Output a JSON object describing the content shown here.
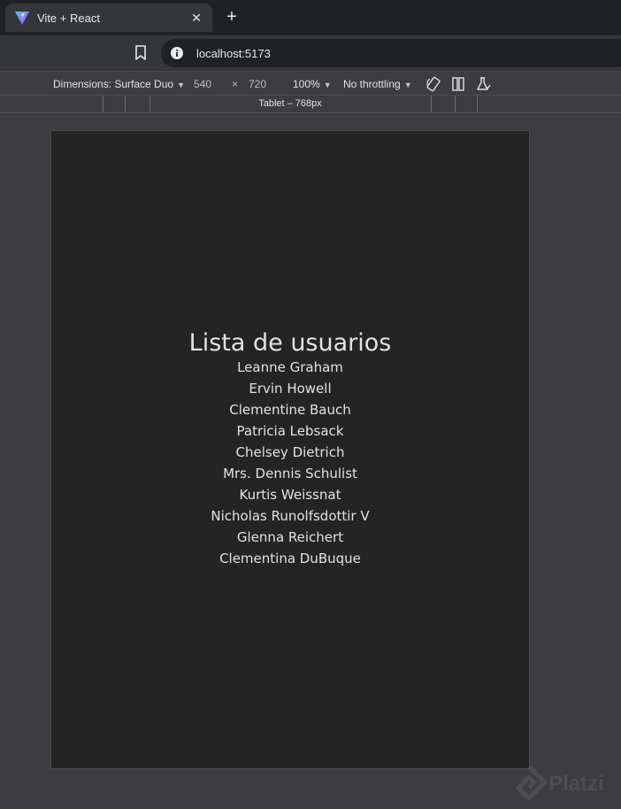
{
  "tab": {
    "title": "Vite + React",
    "close_glyph": "✕",
    "new_tab_glyph": "+"
  },
  "address_bar": {
    "url": "localhost:5173"
  },
  "device_toolbar": {
    "dimensions_label": "Dimensions: Surface Duo",
    "width": "540",
    "times": "×",
    "height": "720",
    "zoom": "100%",
    "throttling": "No throttling"
  },
  "media_query": {
    "label": "Tablet – 768px"
  },
  "app": {
    "heading": "Lista de usuarios",
    "users": [
      "Leanne Graham",
      "Ervin Howell",
      "Clementine Bauch",
      "Patricia Lebsack",
      "Chelsey Dietrich",
      "Mrs. Dennis Schulist",
      "Kurtis Weissnat",
      "Nicholas Runolfsdottir V",
      "Glenna Reichert",
      "Clementina DuBuque"
    ]
  },
  "watermark": {
    "text": "Platzi"
  },
  "colors": {
    "browser_bg": "#3c3c41",
    "viewport_bg": "#242424",
    "tab_bg": "#35363a"
  },
  "icons": [
    "vite-logo-icon",
    "close-icon",
    "plus-icon",
    "bookmark-icon",
    "info-icon",
    "rotate-icon",
    "dual-screen-icon",
    "flask-icon",
    "platzi-logo-icon"
  ]
}
